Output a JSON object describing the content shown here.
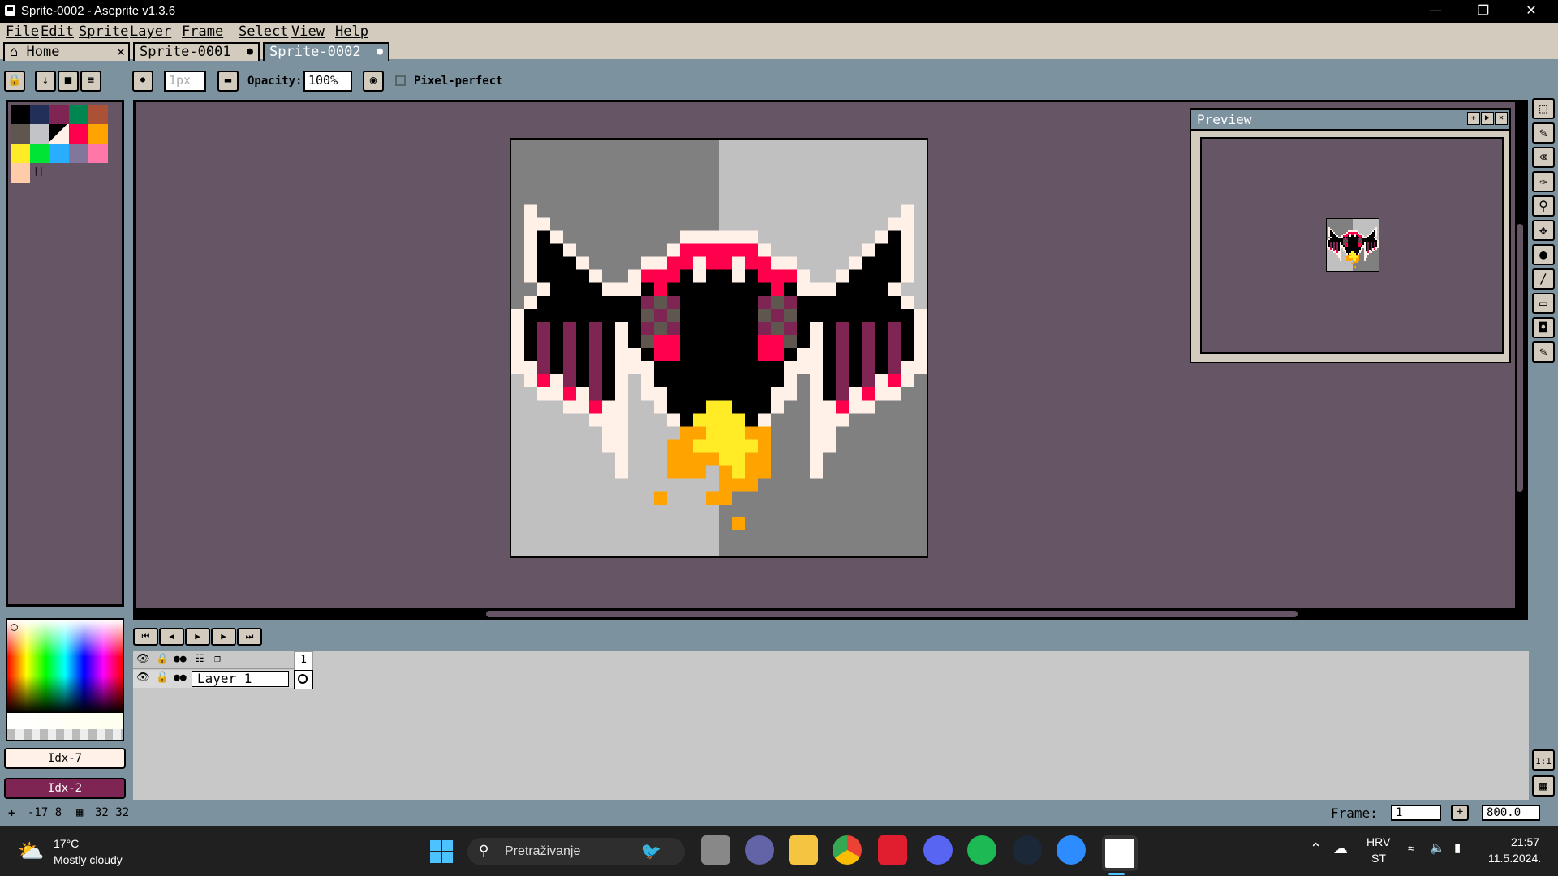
{
  "window": {
    "title": "Sprite-0002 - Aseprite v1.3.6"
  },
  "menu": [
    "File",
    "Edit",
    "Sprite",
    "Layer",
    "Frame",
    "Select",
    "View",
    "Help"
  ],
  "tabs": [
    {
      "label": "Home",
      "close": "✕",
      "active": false
    },
    {
      "label": "Sprite-0001",
      "close": "●",
      "active": false
    },
    {
      "label": "Sprite-0002",
      "close": "●",
      "active": true
    }
  ],
  "toolbar": {
    "brush_size": "1px",
    "opacity_label": "Opacity:",
    "opacity_value": "100%",
    "pixel_perfect_label": "Pixel-perfect",
    "pixel_perfect_checked": false
  },
  "palette": {
    "colors": [
      "#000000",
      "#222f58",
      "#7e2553",
      "#008751",
      "#ab5236",
      "#5f574f",
      "#c2c3c7",
      "#fff1e8",
      "#ff004d",
      "#ffa300",
      "#ffec27",
      "#00e436",
      "#29adff",
      "#83769c",
      "#ff77a8",
      "#ffccaa"
    ],
    "selected_index": 7
  },
  "color_indices": {
    "fg": "Idx-7",
    "bg": "Idx-2"
  },
  "preview": {
    "title": "Preview"
  },
  "timeline": {
    "frame_number": "1",
    "layer_name": "Layer 1"
  },
  "status": {
    "cursor_pos": "-17  8",
    "sprite_size": "32 32",
    "frame_label": "Frame:",
    "frame_value": "1",
    "zoom_value": "800.0"
  },
  "taskbar": {
    "weather_temp": "17°C",
    "weather_desc": "Mostly cloudy",
    "search_placeholder": "Pretraživanje",
    "lang_top": "HRV",
    "lang_bottom": "ST",
    "time": "21:57",
    "date": "11.5.2024."
  },
  "colors": {
    "accent": "#7d929f",
    "canvas_bg": "#665564",
    "panel": "#d3cbbe",
    "sprite_dark": "#808080",
    "sprite_light": "#c0c0c0"
  }
}
